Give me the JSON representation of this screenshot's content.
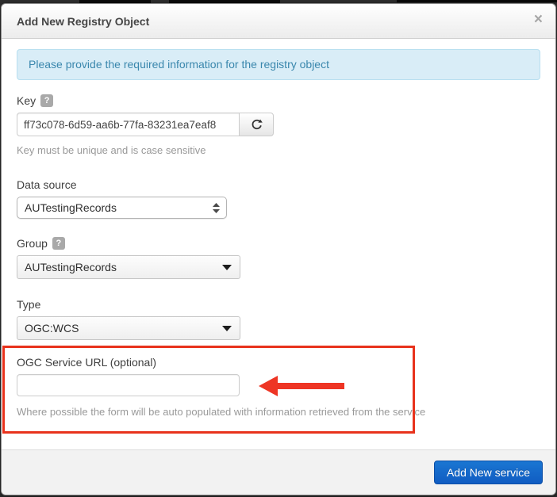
{
  "window": {
    "title": "Add New Registry Object",
    "close_icon": "×"
  },
  "alert": {
    "message": "Please provide the required information for the registry object"
  },
  "form": {
    "key": {
      "label": "Key",
      "help_badge": "?",
      "value": "ff73c078-6d59-aa6b-77fa-83231ea7eaf8",
      "help": "Key must be unique and is case sensitive"
    },
    "data_source": {
      "label": "Data source",
      "value": "AUTestingRecords"
    },
    "group": {
      "label": "Group",
      "help_badge": "?",
      "value": "AUTestingRecords"
    },
    "type": {
      "label": "Type",
      "value": "OGC:WCS"
    },
    "ogc_url": {
      "label": "OGC Service URL (optional)",
      "value": "",
      "help": "Where possible the form will be auto populated with information retrieved from the service"
    }
  },
  "footer": {
    "submit_label": "Add New service"
  },
  "annotation": {
    "highlight_color": "#e8321c",
    "arrow_color": "#ee3524"
  },
  "colors": {
    "primary_button": "#1467cc",
    "alert_bg": "#d9edf7",
    "alert_text": "#3a87ad"
  }
}
